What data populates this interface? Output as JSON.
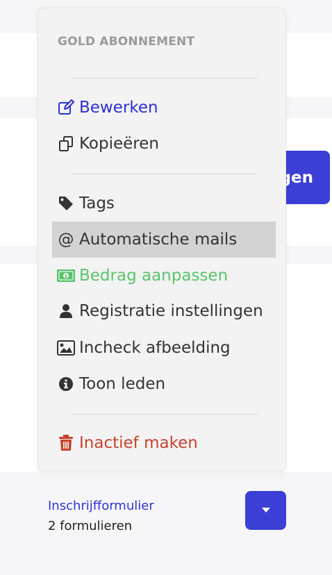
{
  "background": {
    "button_label": "gen",
    "form": {
      "link_label": "Inschrijfformulier",
      "count_label": "2 formulieren"
    }
  },
  "dropdown": {
    "header": "GOLD ABONNEMENT",
    "items": [
      {
        "label": "Bewerken",
        "icon": "edit-icon",
        "color": "#2d2fd6"
      },
      {
        "label": "Kopieëren",
        "icon": "copy-icon",
        "color": "#333333"
      },
      {
        "label": "Tags",
        "icon": "tag-icon",
        "color": "#333333"
      },
      {
        "label": "Automatische mails",
        "icon": "at-icon",
        "color": "#333333",
        "active": true
      },
      {
        "label": "Bedrag aanpassen",
        "icon": "money-icon",
        "color": "#58c46c"
      },
      {
        "label": "Registratie instellingen",
        "icon": "user-icon",
        "color": "#333333"
      },
      {
        "label": "Incheck afbeelding",
        "icon": "image-icon",
        "color": "#333333"
      },
      {
        "label": "Toon leden",
        "icon": "info-icon",
        "color": "#333333"
      },
      {
        "label": "Inactief maken",
        "icon": "trash-icon",
        "color": "#c8432a"
      }
    ]
  }
}
